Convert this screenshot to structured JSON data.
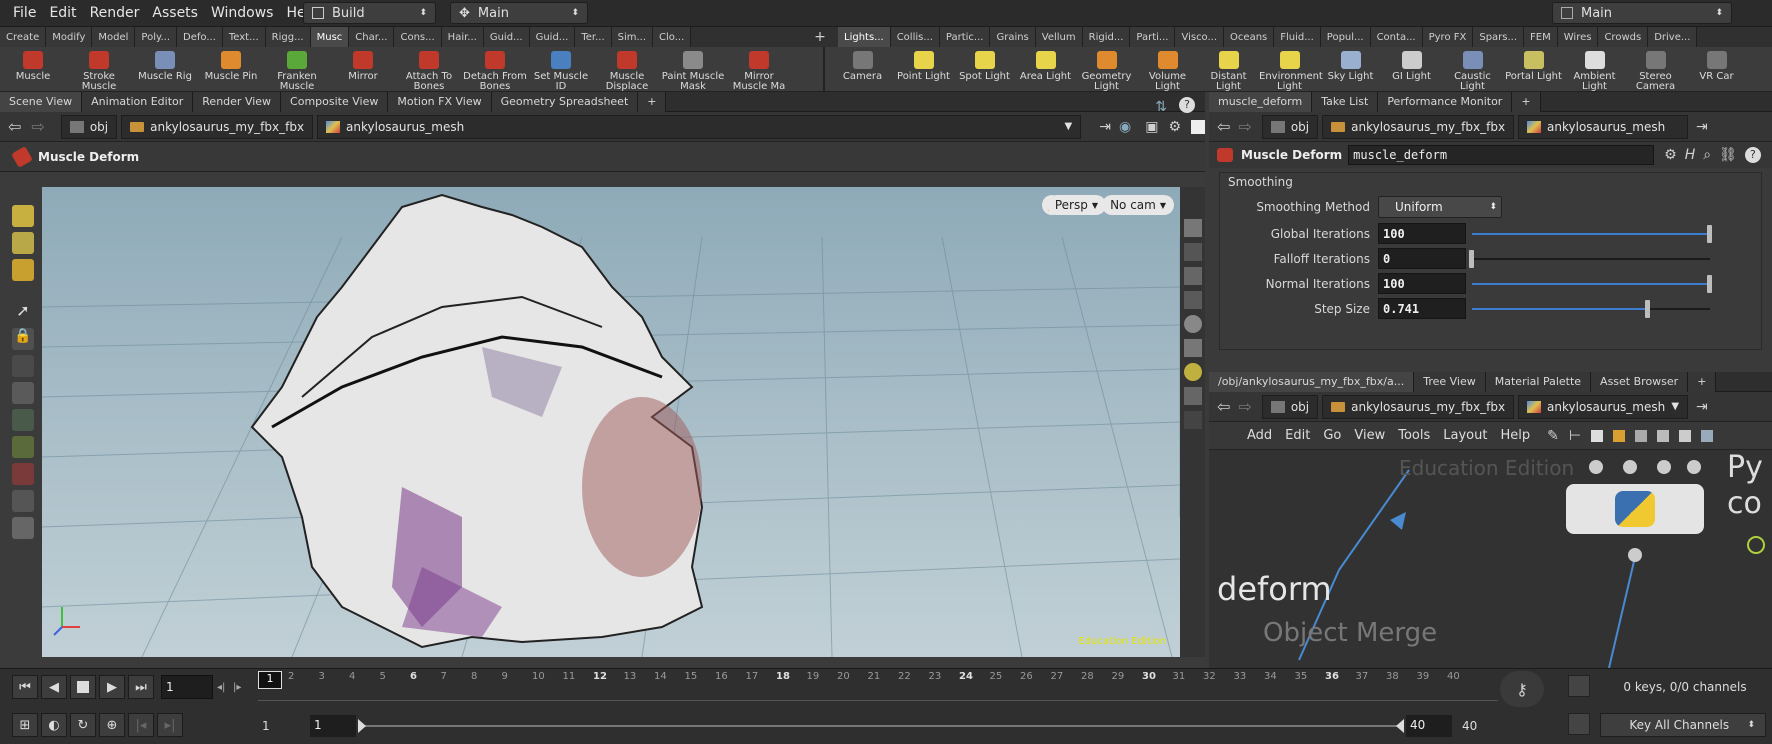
{
  "menubar": {
    "items": [
      "File",
      "Edit",
      "Render",
      "Assets",
      "Windows",
      "Help"
    ],
    "desktop": "Build",
    "context": "Main",
    "right_desktop": "Main"
  },
  "shelf_tabs_left": [
    "Create",
    "Modify",
    "Model",
    "Poly...",
    "Defo...",
    "Text...",
    "Rigg...",
    "Musc",
    "Char...",
    "Cons...",
    "Hair...",
    "Guid...",
    "Guid...",
    "Ter...",
    "Sim...",
    "Clo..."
  ],
  "shelf_tabs_right": [
    "Lights...",
    "Collis...",
    "Partic...",
    "Grains",
    "Vellum",
    "Rigid...",
    "Parti...",
    "Visco...",
    "Oceans",
    "Fluid...",
    "Popul...",
    "Conta...",
    "Pyro FX",
    "Spars...",
    "FEM",
    "Wires",
    "Crowds",
    "Drive..."
  ],
  "shelf_tools_left": [
    {
      "label": "Muscle",
      "color": "#c0392b"
    },
    {
      "label": "Stroke Muscle",
      "color": "#c0392b"
    },
    {
      "label": "Muscle Rig",
      "color": "#7a8fb8"
    },
    {
      "label": "Muscle Pin",
      "color": "#e08a30"
    },
    {
      "label": "Franken Muscle",
      "color": "#5aa83a"
    },
    {
      "label": "Mirror",
      "color": "#c0392b"
    },
    {
      "label": "Attach To Bones",
      "color": "#c0392b"
    },
    {
      "label": "Detach From Bones",
      "color": "#c0392b"
    },
    {
      "label": "Set Muscle ID",
      "color": "#4a7fc0"
    },
    {
      "label": "Muscle Displace",
      "color": "#c0392b"
    },
    {
      "label": "Paint Muscle Mask",
      "color": "#8a8a8a"
    },
    {
      "label": "Mirror Muscle Ma",
      "color": "#c0392b"
    }
  ],
  "shelf_tools_right": [
    {
      "label": "Camera",
      "color": "#777"
    },
    {
      "label": "Point Light",
      "color": "#e8d44a"
    },
    {
      "label": "Spot Light",
      "color": "#e8d44a"
    },
    {
      "label": "Area Light",
      "color": "#e8d44a"
    },
    {
      "label": "Geometry Light",
      "color": "#e08a30"
    },
    {
      "label": "Volume Light",
      "color": "#e08a30"
    },
    {
      "label": "Distant Light",
      "color": "#e8d44a"
    },
    {
      "label": "Environment Light",
      "color": "#e8d44a"
    },
    {
      "label": "Sky Light",
      "color": "#9ab0d0"
    },
    {
      "label": "GI Light",
      "color": "#cccccc"
    },
    {
      "label": "Caustic Light",
      "color": "#7a8fb8"
    },
    {
      "label": "Portal Light",
      "color": "#c8c060"
    },
    {
      "label": "Ambient Light",
      "color": "#dddddd"
    },
    {
      "label": "Stereo Camera",
      "color": "#777"
    },
    {
      "label": "VR Car",
      "color": "#777"
    }
  ],
  "left_pane": {
    "tabs": [
      "Scene View",
      "Animation Editor",
      "Render View",
      "Composite View",
      "Motion FX View",
      "Geometry Spreadsheet"
    ],
    "path": [
      "obj",
      "ankylosaurus_my_fbx_fbx",
      "ankylosaurus_mesh"
    ],
    "tool_title": "Muscle Deform",
    "persp_label": "Persp",
    "cam_label": "No cam",
    "watermark": "Education Edition"
  },
  "param_pane": {
    "tabs": [
      "muscle_deform",
      "Take List",
      "Performance Monitor"
    ],
    "path": [
      "obj",
      "ankylosaurus_my_fbx_fbx",
      "ankylosaurus_mesh"
    ],
    "node_type": "Muscle Deform",
    "node_name": "muscle_deform",
    "section": "Smoothing",
    "method_label": "Smoothing Method",
    "method_value": "Uniform",
    "params": [
      {
        "label": "Global Iterations",
        "value": "100",
        "fraction": 1.0
      },
      {
        "label": "Falloff Iterations",
        "value": "0",
        "fraction": 0.0
      },
      {
        "label": "Normal Iterations",
        "value": "100",
        "fraction": 1.0
      },
      {
        "label": "Step Size",
        "value": "0.741",
        "fraction": 0.74
      }
    ]
  },
  "network_pane": {
    "tabs": [
      "/obj/ankylosaurus_my_fbx_fbx/a...",
      "Tree View",
      "Material Palette",
      "Asset Browser"
    ],
    "path": [
      "obj",
      "ankylosaurus_my_fbx_fbx",
      "ankylosaurus_mesh"
    ],
    "menu": [
      "Add",
      "Edit",
      "Go",
      "View",
      "Tools",
      "Layout",
      "Help"
    ],
    "watermark": "Education Edition",
    "node_left_label": "deform",
    "node_merge_label": "Object Merge",
    "node_right_label": "Py",
    "node_right_label2": "co"
  },
  "timeline": {
    "current_frame": "1",
    "frame_marker": "1",
    "ticks": [
      "2",
      "3",
      "4",
      "5",
      "6",
      "7",
      "8",
      "9",
      "10",
      "11",
      "12",
      "13",
      "14",
      "15",
      "16",
      "17",
      "18",
      "19",
      "20",
      "21",
      "22",
      "23",
      "24",
      "25",
      "26",
      "27",
      "28",
      "29",
      "30",
      "31",
      "32",
      "33",
      "34",
      "35",
      "36",
      "37",
      "38",
      "39",
      "40"
    ],
    "range_start": "1",
    "range_start2": "1",
    "range_end": "40",
    "range_end2": "40",
    "keys_info": "0 keys, 0/0 channels",
    "key_all": "Key All Channels"
  }
}
